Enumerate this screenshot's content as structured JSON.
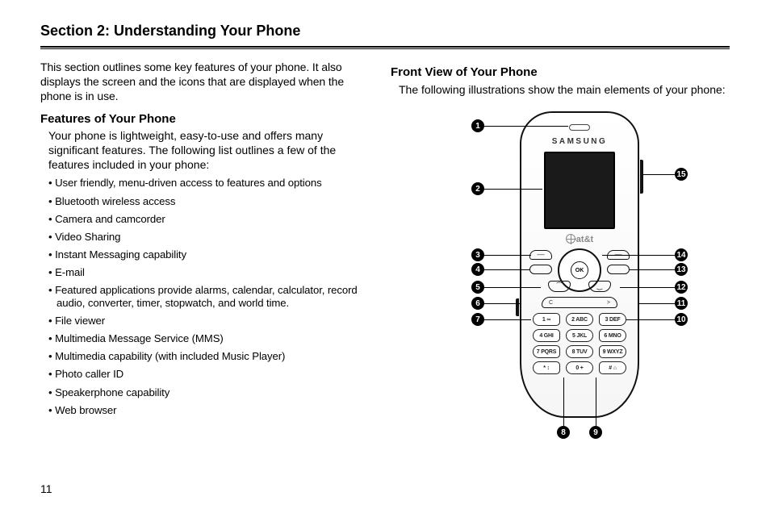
{
  "section_title": "Section 2: Understanding Your Phone",
  "page_number": "11",
  "left": {
    "intro": "This section outlines some key features of your phone. It also displays the screen and the icons that are displayed when the phone is in use.",
    "features_heading": "Features of Your Phone",
    "features_lead": "Your phone is lightweight, easy-to-use and offers many significant features. The following list outlines a few of the features included in your phone:",
    "features": [
      "User friendly, menu-driven access to features and options",
      "Bluetooth wireless access",
      "Camera and camcorder",
      "Video Sharing",
      "Instant Messaging capability",
      "E-mail",
      "Featured applications provide alarms, calendar, calculator, record audio, converter, timer, stopwatch, and world time.",
      "File viewer",
      "Multimedia Message Service (MMS)",
      "Multimedia capability (with included Music Player)",
      "Photo caller ID",
      "Speakerphone capability",
      "Web browser"
    ]
  },
  "right": {
    "heading": "Front View of Your Phone",
    "intro": "The following illustrations show the main elements of your phone:"
  },
  "phone": {
    "brand": "SAMSUNG",
    "carrier": "at&t",
    "ok": "OK",
    "clear_left": "C",
    "clear_right": ">",
    "keys": [
      [
        "1 ∞",
        "2 ABC",
        "3 DEF"
      ],
      [
        "4 GHI",
        "5 JKL",
        "6 MNO"
      ],
      [
        "7 PQRS",
        "8 TUV",
        "9 WXYZ"
      ],
      [
        "* ↕",
        "0 +",
        "# ⌂"
      ]
    ],
    "callouts": [
      "1",
      "2",
      "3",
      "4",
      "5",
      "6",
      "7",
      "8",
      "9",
      "10",
      "11",
      "12",
      "13",
      "14",
      "15"
    ]
  }
}
